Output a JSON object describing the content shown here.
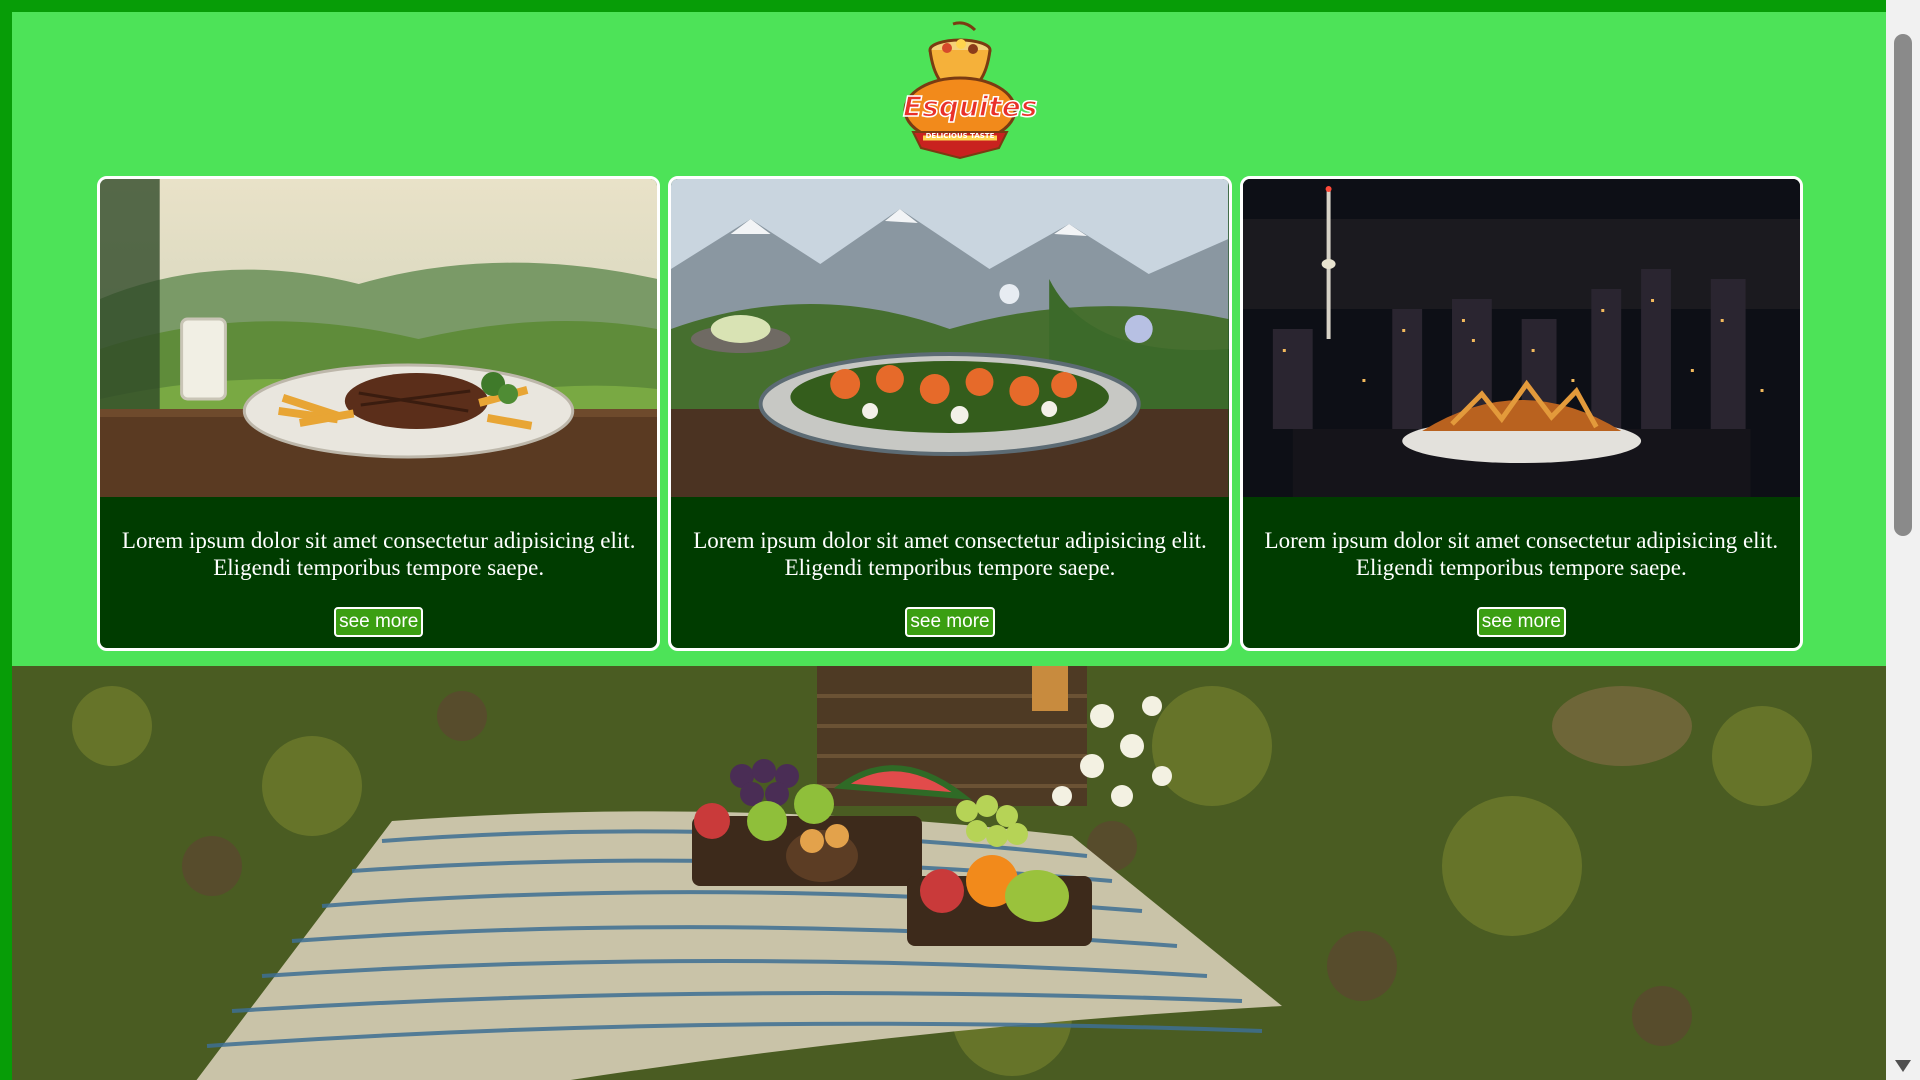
{
  "logo": {
    "name": "Esquites",
    "tagline": "DELICIOUS TASTE"
  },
  "cards": [
    {
      "image": "steak-plate-countryside-image",
      "text": "Lorem ipsum dolor sit amet consectetur adipisicing elit. Eligendi temporibus tempore saepe.",
      "button_label": "see more"
    },
    {
      "image": "salad-platter-mountains-image",
      "text": "Lorem ipsum dolor sit amet consectetur adipisicing elit. Eligendi temporibus tempore saepe.",
      "button_label": "see more"
    },
    {
      "image": "nachos-city-night-image",
      "text": "Lorem ipsum dolor sit amet consectetur adipisicing elit. Eligendi temporibus tempore saepe.",
      "button_label": "see more"
    }
  ],
  "hero": {
    "image": "picnic-blanket-fruit-image"
  },
  "colors": {
    "page_border": "#079d07",
    "page_background": "#4de358",
    "card_background": "#003c00",
    "button_background": "#3b9f12"
  }
}
